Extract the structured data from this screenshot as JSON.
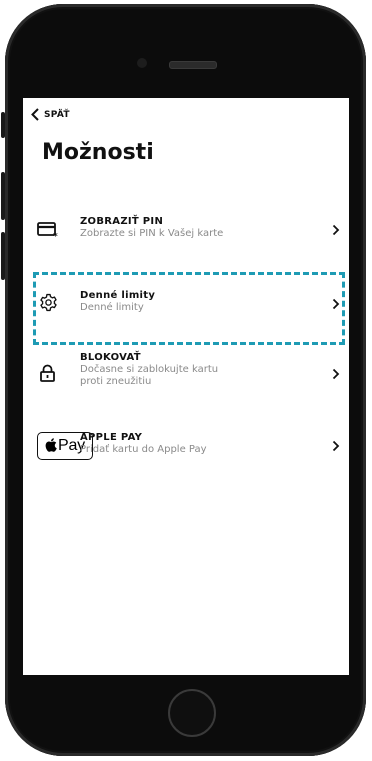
{
  "nav": {
    "back_label": "SPÄŤ"
  },
  "page": {
    "title": "Možnosti"
  },
  "options": [
    {
      "title": "ZOBRAZIŤ PIN",
      "subtitle": "Zobrazte si PIN k Vašej karte",
      "icon": "card-pin-icon"
    },
    {
      "title": "Denné limity",
      "subtitle": "Denné limity",
      "icon": "gear-icon"
    },
    {
      "title": "BLOKOVAŤ",
      "subtitle": "Dočasne si zablokujte kartu\nproti zneužitiu",
      "icon": "lock-icon"
    },
    {
      "title": "APPLE PAY",
      "subtitle": "Pridať kartu do Apple Pay",
      "icon": "apple-pay-icon",
      "badge_text": "Pay"
    }
  ],
  "colors": {
    "highlight": "#1e9bb4",
    "text_primary": "#111111",
    "text_secondary": "#8a8a8a"
  }
}
